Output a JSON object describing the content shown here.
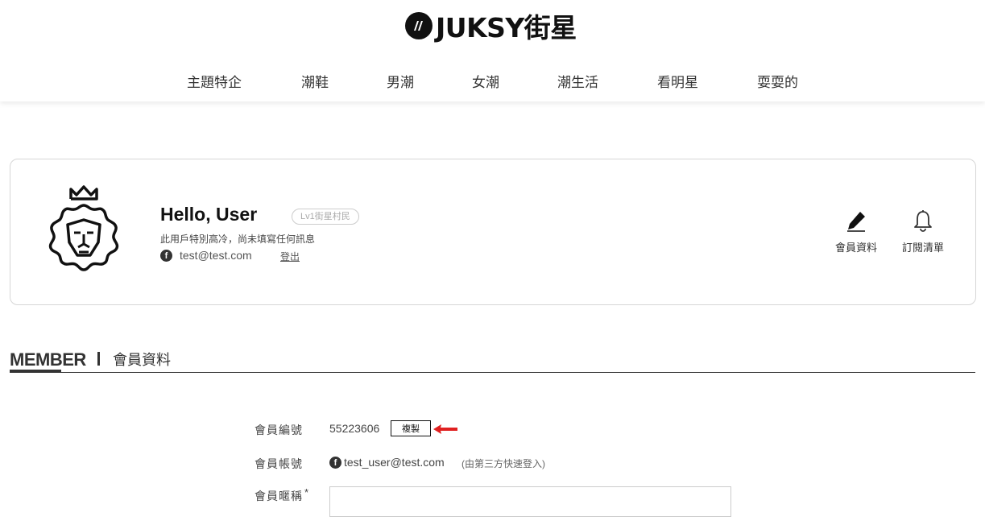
{
  "brand": {
    "name": "JUKSY街星",
    "mark": "//"
  },
  "nav": [
    {
      "label": "主題特企"
    },
    {
      "label": "潮鞋"
    },
    {
      "label": "男潮"
    },
    {
      "label": "女潮"
    },
    {
      "label": "潮生活"
    },
    {
      "label": "看明星"
    },
    {
      "label": "耍耍的"
    }
  ],
  "profile": {
    "greeting": "Hello, User",
    "level": "Lv1街星村民",
    "bio": "此用戶特別高冷，尚未填寫任何訊息",
    "fb_icon": "f",
    "email": "test@test.com",
    "logout": "登出",
    "actions": [
      {
        "label": "會員資料",
        "icon": "pencil-icon"
      },
      {
        "label": "訂閱清單",
        "icon": "bell-icon"
      }
    ]
  },
  "section": {
    "title_en": "MEMBER",
    "title_zh": "會員資料"
  },
  "form": {
    "member_id": {
      "label": "會員編號",
      "value": "55223606",
      "copy": "複製"
    },
    "account": {
      "label": "會員帳號",
      "value": "test_user@test.com",
      "note": "(由第三方快速登入)"
    },
    "nickname": {
      "label": "會員暱稱",
      "required": "*",
      "value": ""
    }
  },
  "colors": {
    "accent": "#111111",
    "arrow": "#e02020"
  }
}
